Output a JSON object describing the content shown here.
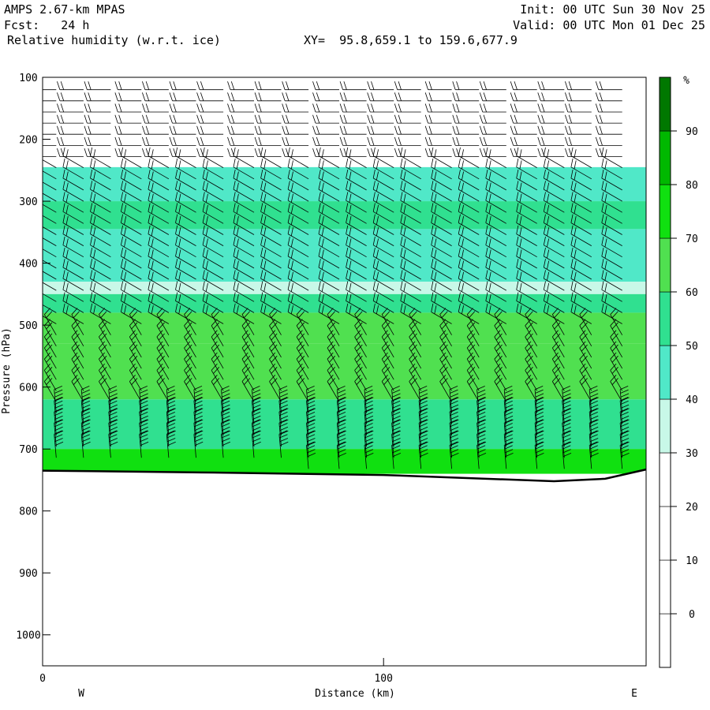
{
  "header": {
    "model": "AMPS 2.67-km MPAS",
    "fcst": "Fcst:   24 h",
    "field": "Relative humidity (w.r.t. ice)",
    "xy": "XY=  95.8,659.1 to 159.6,677.9",
    "init": "Init: 00 UTC Sun 30 Nov 25",
    "valid": "Valid: 00 UTC Mon 01 Dec 25"
  },
  "chart_data": {
    "type": "heatmap",
    "ylabel": "Pressure (hPa)",
    "xlabel": "Distance (km)",
    "x_range": [
      0,
      177
    ],
    "y_range": [
      1050,
      100
    ],
    "y_ticks": [
      "100",
      "200",
      "300",
      "400",
      "500",
      "600",
      "700",
      "800",
      "900",
      "1000"
    ],
    "y_tick_values": [
      100,
      200,
      300,
      400,
      500,
      600,
      700,
      800,
      900,
      1000
    ],
    "x_ticks": [
      "0",
      "100"
    ],
    "x_tick_values": [
      0,
      100
    ],
    "x_end_labels": [
      "W",
      "E"
    ],
    "colorbar": {
      "unit": "%",
      "labels": [
        "90",
        "80",
        "70",
        "60",
        "50",
        "40",
        "30",
        "20",
        "10",
        "0"
      ],
      "label_values": [
        90,
        80,
        70,
        60,
        50,
        40,
        30,
        20,
        10,
        0
      ],
      "levels": [
        -10,
        0,
        10,
        20,
        30,
        40,
        50,
        60,
        70,
        80,
        90,
        100
      ],
      "colors": [
        "#ffffff",
        "#ffffff",
        "#ffffff",
        "#ffffff",
        "#c8f8e8",
        "#50e8c8",
        "#30e090",
        "#50e050",
        "#10e010",
        "#00b800",
        "#007800"
      ]
    },
    "rh_layers": [
      {
        "p_top": 245,
        "p_bot": 300,
        "rh": 45
      },
      {
        "p_top": 300,
        "p_bot": 345,
        "rh": 52
      },
      {
        "p_top": 345,
        "p_bot": 430,
        "rh": 48
      },
      {
        "p_top": 430,
        "p_bot": 450,
        "rh": 35
      },
      {
        "p_top": 450,
        "p_bot": 480,
        "rh": 55
      },
      {
        "p_top": 480,
        "p_bot": 530,
        "rh": 68
      },
      {
        "p_top": 530,
        "p_bot": 620,
        "rh": 60
      },
      {
        "p_top": 620,
        "p_bot": 700,
        "rh": 55
      },
      {
        "p_top": 700,
        "p_bot": 740,
        "rh": 72
      }
    ],
    "surface_pressure": [
      {
        "x": 0,
        "p": 735
      },
      {
        "x": 50,
        "p": 738
      },
      {
        "x": 100,
        "p": 742
      },
      {
        "x": 150,
        "p": 752
      },
      {
        "x": 165,
        "p": 748
      },
      {
        "x": 177,
        "p": 733
      }
    ],
    "wind_barbs": {
      "x_positions": [
        4,
        12,
        20,
        29,
        37,
        45,
        53,
        62,
        70,
        78,
        87,
        95,
        103,
        111,
        120,
        128,
        136,
        145,
        153,
        161,
        170
      ],
      "p_top": 120,
      "p_step": 18
    }
  }
}
